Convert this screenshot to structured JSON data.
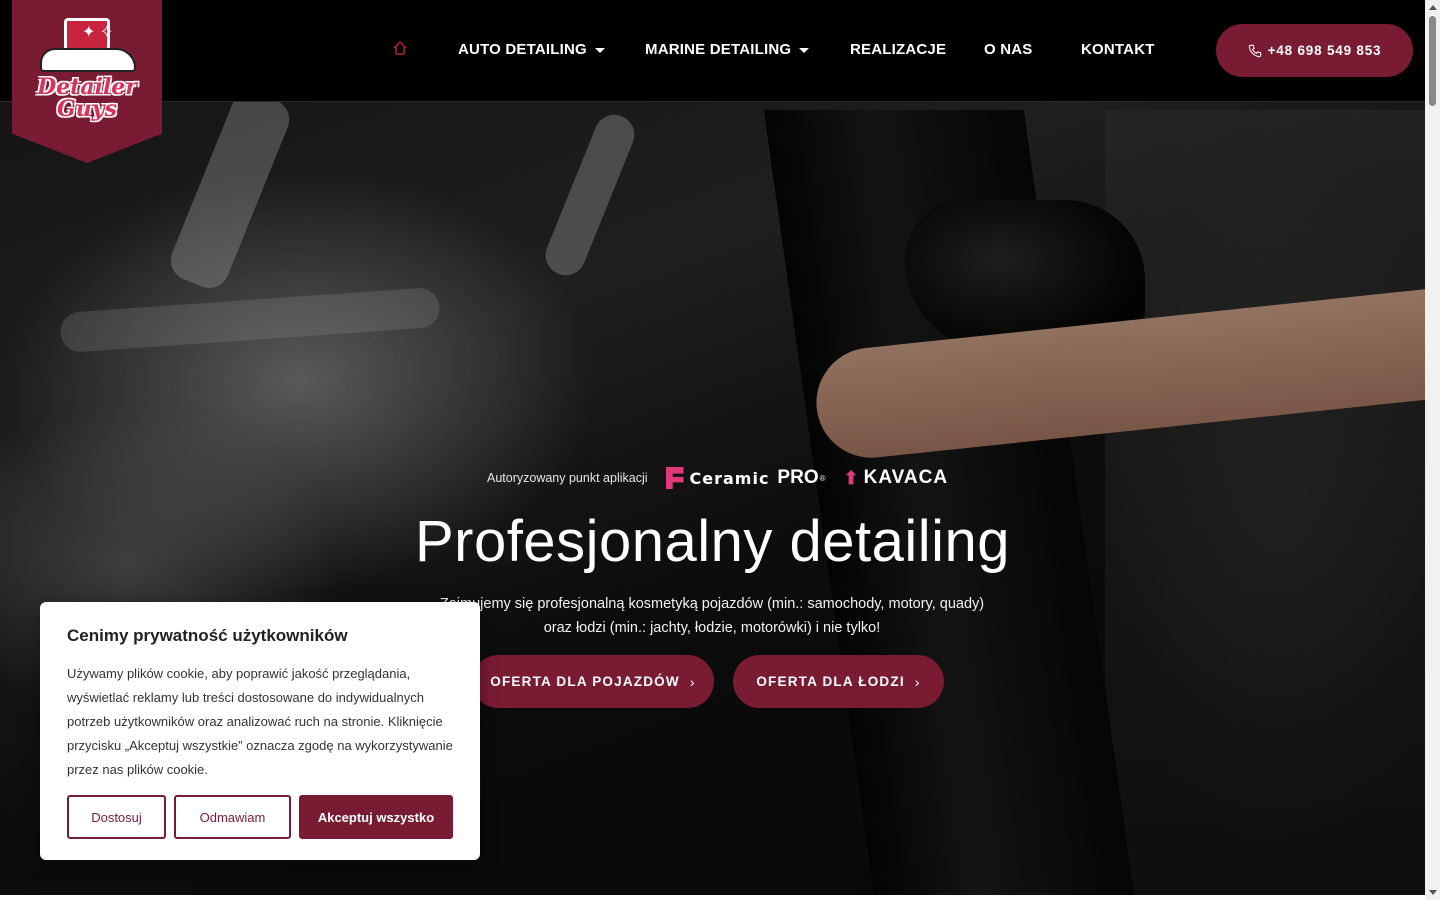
{
  "brand": {
    "logo_text": "Detailer Guys"
  },
  "nav": {
    "home_icon": "home-icon",
    "items": [
      {
        "label": "AUTO DETAILING",
        "dropdown": true
      },
      {
        "label": "MARINE DETAILING",
        "dropdown": true
      },
      {
        "label": "REALIZACJE",
        "dropdown": false
      },
      {
        "label": "O NAS",
        "dropdown": false
      },
      {
        "label": "KONTAKT",
        "dropdown": false
      }
    ],
    "phone": "+48 698 549 853"
  },
  "hero": {
    "authorized_text": "Autoryzowany punkt aplikacji",
    "partner1": {
      "name_part1": "Ceramic",
      "name_part2": "PRO",
      "trademark": "®"
    },
    "partner2": {
      "name": "KAVACA"
    },
    "title": "Profesjonalny detailing",
    "subtitle_line1": "Zajmujemy się profesjonalną kosmetyką pojazdów (min.: samochody, motory, quady)",
    "subtitle_line2": "oraz łodzi (min.: jachty, łodzie, motorówki) i nie tylko!",
    "cta_vehicles": "OFERTA DLA POJAZDÓW",
    "cta_boats": "OFERTA DLA ŁODZI"
  },
  "cookie": {
    "title": "Cenimy prywatność użytkowników",
    "body": "Używamy plików cookie, aby poprawić jakość przeglądania, wyświetlać reklamy lub treści dostosowane do indywidualnych potrzeb użytkowników oraz analizować ruch na stronie. Kliknięcie przycisku „Akceptuj wszystkie” oznacza zgodę na wykorzystywanie przez nas plików cookie.",
    "btn_customize": "Dostosuj",
    "btn_reject": "Odmawiam",
    "btn_accept": "Akceptuj wszystko"
  },
  "colors": {
    "accent": "#7a1b34",
    "partner_pink": "#e03a7a"
  }
}
